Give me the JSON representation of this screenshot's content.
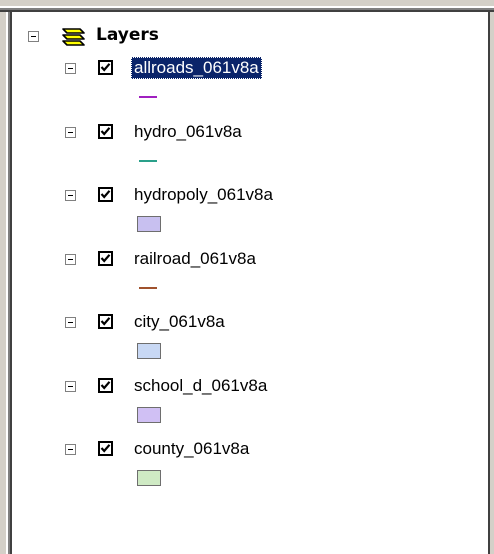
{
  "root": {
    "label": "Layers",
    "icon": "layers-stack-icon",
    "icon_color": "#ffff00"
  },
  "layers": [
    {
      "name": "allroads_061v8a",
      "checked": true,
      "selected": true,
      "symbol": "line",
      "color": "#a020c0"
    },
    {
      "name": "hydro_061v8a",
      "checked": true,
      "selected": false,
      "symbol": "line",
      "color": "#2aa08a"
    },
    {
      "name": "hydropoly_061v8a",
      "checked": true,
      "selected": false,
      "symbol": "fill",
      "color": "#c8c0f0"
    },
    {
      "name": "railroad_061v8a",
      "checked": true,
      "selected": false,
      "symbol": "line",
      "color": "#a0522d"
    },
    {
      "name": "city_061v8a",
      "checked": true,
      "selected": false,
      "symbol": "fill",
      "color": "#c8d8f4"
    },
    {
      "name": "school_d_061v8a",
      "checked": true,
      "selected": false,
      "symbol": "fill",
      "color": "#d0c0f4"
    },
    {
      "name": "county_061v8a",
      "checked": true,
      "selected": false,
      "symbol": "fill",
      "color": "#cfeac4"
    }
  ],
  "colors": {
    "selection_bg": "#0a246a",
    "selection_text": "#ffffff"
  }
}
